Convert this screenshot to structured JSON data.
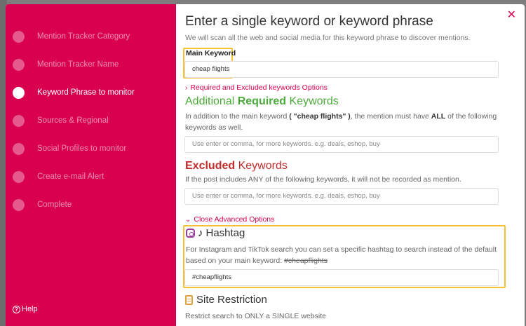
{
  "sidebar": {
    "steps": [
      {
        "label": "Mention Tracker Category"
      },
      {
        "label": "Mention Tracker Name"
      },
      {
        "label": "Keyword Phrase to monitor"
      },
      {
        "label": "Sources & Regional"
      },
      {
        "label": "Social Profiles to monitor"
      },
      {
        "label": "Create e-mail Alert"
      },
      {
        "label": "Complete"
      }
    ],
    "active_step": 2,
    "help_label": "Help",
    "help_icon": "question-circle-icon"
  },
  "modal": {
    "close_icon": "close-icon",
    "title": "Enter a single keyword or keyword phrase",
    "subtitle": "We will scan all the web and social media for this keyword phrase to discover mentions.",
    "main_keyword": {
      "label": "Main Keyword",
      "value": "cheap flights"
    },
    "required_excluded_toggle": "Required and Excluded keywords Options",
    "additional": {
      "title_prefix": "Additional ",
      "title_bold": "Required",
      "title_suffix": " Keywords",
      "desc_1": "In addition to the main keyword ",
      "desc_keyword": "( \"cheap flights\" )",
      "desc_2": ", the mention must have ",
      "desc_all": "ALL",
      "desc_3": " of the following keywords as well.",
      "placeholder": "Use enter or comma, for more keywords. e.g. deals, eshop, buy"
    },
    "excluded": {
      "title_bold": "Excluded",
      "title_suffix": " Keywords",
      "desc": "If the post includes ANY of the following keywords, it will not be recorded as mention.",
      "placeholder": "Use enter or comma, for more keywords. e.g. deals, eshop, buy"
    },
    "advanced_toggle": "Close Advanced Options",
    "hashtag": {
      "title": "Hashtag",
      "desc_1": "For Instagram and TikTok search you can set a specific hashtag to search instead of the default based on your main keyword: ",
      "desc_strike": "#cheapflights",
      "value": "#cheapflights",
      "icons": [
        "instagram-icon",
        "tiktok-icon"
      ]
    },
    "site_restriction": {
      "title": "Site Restriction",
      "desc": "Restrict search to ONLY a SINGLE website",
      "icon": "document-icon"
    }
  },
  "colors": {
    "brand": "#d8004f",
    "required_green": "#4caa3b",
    "excluded_red": "#c42b2b",
    "highlight": "#f6c232"
  }
}
